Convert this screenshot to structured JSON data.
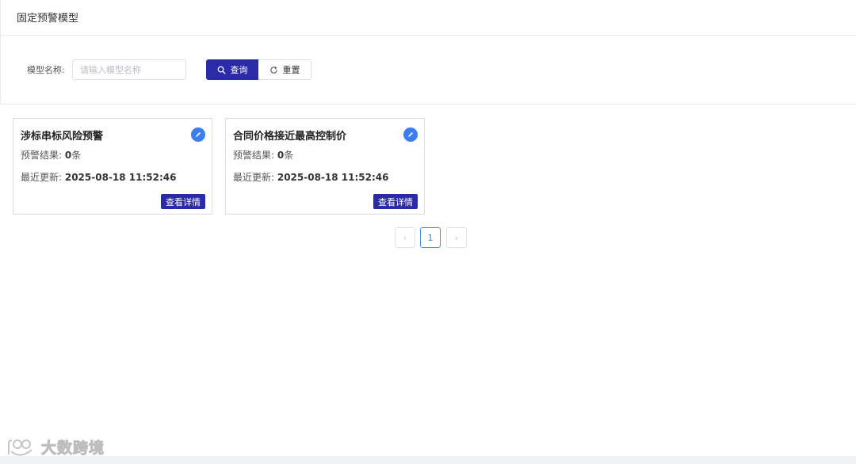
{
  "header": {
    "title": "固定预警模型"
  },
  "filter": {
    "label": "模型名称:",
    "input_placeholder": "请输入模型名称",
    "input_value": "",
    "query_label": "查询",
    "reset_label": "重置"
  },
  "cards": [
    {
      "title": "涉标串标风险预警",
      "result_label": "预警结果: ",
      "result_count": "0",
      "result_unit": "条",
      "update_label": "最近更新: ",
      "update_time": "2025-08-18 11:52:46",
      "detail_label": "查看详情"
    },
    {
      "title": "合同价格接近最高控制价",
      "result_label": "预警结果: ",
      "result_count": "0",
      "result_unit": "条",
      "update_label": "最近更新: ",
      "update_time": "2025-08-18 11:52:46",
      "detail_label": "查看详情"
    }
  ],
  "pagination": {
    "prev": "‹",
    "current_page": "1",
    "next": "›"
  },
  "watermark": {
    "text": "大数跨境"
  },
  "colors": {
    "primary": "#2b2ba8",
    "edit_icon": "#3d7df0",
    "page_active": "#4a8fdc"
  }
}
